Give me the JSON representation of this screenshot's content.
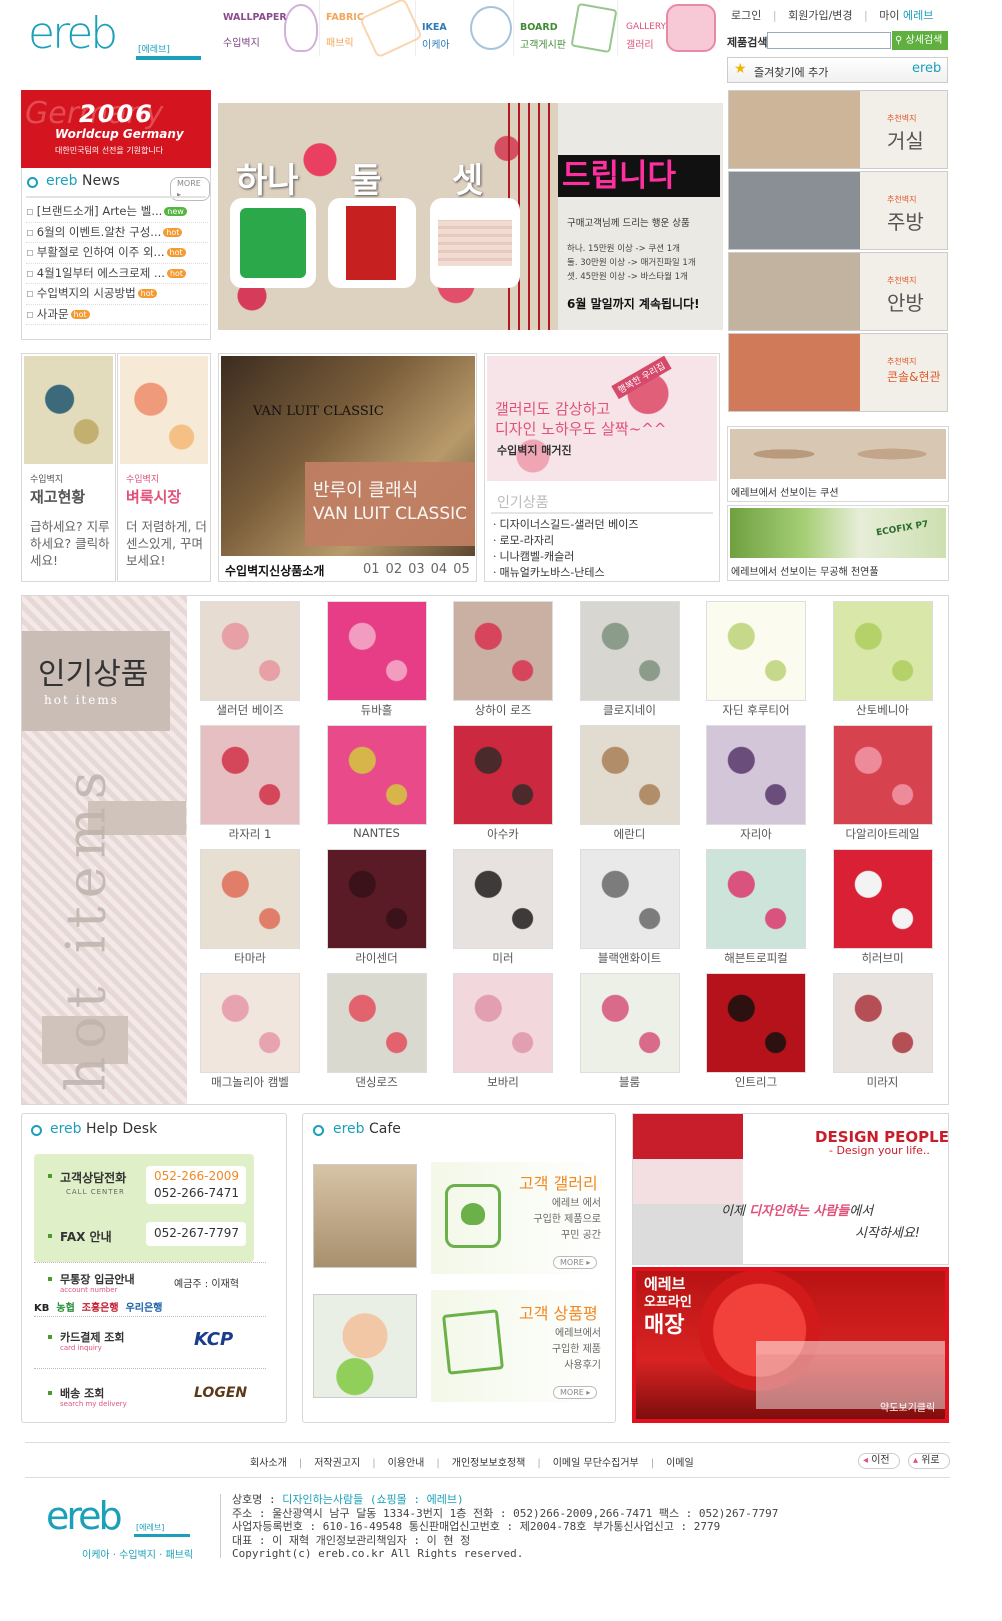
{
  "logo": {
    "text": "ereb",
    "sub": "[에레브]"
  },
  "topnav": [
    {
      "en": "WALLPAPER",
      "ko": "수입벽지"
    },
    {
      "en": "FABRIC",
      "ko": "패브릭"
    },
    {
      "en": "IKEA",
      "ko": "이케아"
    },
    {
      "en": "BOARD",
      "ko": "고객게시판"
    },
    {
      "en": "GALLERY",
      "ko": "갤러리"
    }
  ],
  "util": {
    "login": "로그인",
    "join": "회원가입/변경",
    "mypage": "마이",
    "mypage_brand": "에레브",
    "search_label": "제품검색",
    "search_placeholder": "",
    "search_btn": "상세검색",
    "favorite": "즐겨찾기에 추가",
    "fav_logo": "ereb"
  },
  "worldcup": {
    "year": "2006",
    "title": "Worldcup Germany",
    "bgtext": "Germany",
    "sub": "대한민국팀의 선전을 기원합니다"
  },
  "news": {
    "brand": "ereb",
    "title": "News",
    "more": "MORE ▸",
    "items": [
      {
        "text": "[브랜드소개] Arte는 벨...",
        "badge": "new"
      },
      {
        "text": "6월의 이벤트.알찬 구성...",
        "badge": "hot"
      },
      {
        "text": "부활절로 인하여 이주 외...",
        "badge": "hot"
      },
      {
        "text": "4월1일부터 에스크로제 ...",
        "badge": "hot"
      },
      {
        "text": "수입벽지의 시공방법",
        "badge": "hot"
      },
      {
        "text": "사과문",
        "badge": "hot"
      }
    ]
  },
  "banner": {
    "w1": "하나",
    "w2": "둘",
    "w3": "셋",
    "headline": "드립니다",
    "sub": "구매고객님께 드리는 행운 상품",
    "l1": "하나. 15만원 이상 -> 쿠션 1개",
    "l2": "둘. 30만원 이상 -> 매거진파일 1개",
    "l3": "셋. 45만원 이상 -> 바스타월 1개",
    "foot": "6월 말일까지 계속됩니다!"
  },
  "rooms": [
    {
      "tag": "추천벽지",
      "name": "거실"
    },
    {
      "tag": "추천벽지",
      "name": "주방"
    },
    {
      "tag": "추천벽지",
      "name": "안방"
    },
    {
      "tag": "추천벽지",
      "name": "콘솔&현관"
    }
  ],
  "stock": {
    "tag": "수입벽지",
    "title": "재고현황",
    "copy": "급하세요? 지루하세요? 클릭하세요!"
  },
  "flea": {
    "tag": "수입벽지",
    "title": "벼룩시장",
    "copy": "더 저렴하게, 더 센스있게, 꾸며보세요!"
  },
  "vanluit": {
    "overlay": "VAN LUIT CLASSIC",
    "title_ko": "반루이 클래식",
    "title_en": "VAN LUIT CLASSIC",
    "caption": "수입벽지신상품소개",
    "pages": [
      "01",
      "02",
      "03",
      "04",
      "05"
    ]
  },
  "gallery_banner": {
    "l1": "갤러리도 감상하고",
    "l2": "디자인 노하우도 살짝~^^",
    "l3": "수입벽지 매거진",
    "badge": "행복한 우리집"
  },
  "popular_small": {
    "title": "인기상품",
    "items": [
      "디자이너스길드-샐러던 베이즈",
      "로모-라자리",
      "니나캠벨-캐슬러",
      "매뉴얼카노바스-난테스"
    ]
  },
  "cushion": {
    "caption": "에레브에서 선보이는 쿠션"
  },
  "ecofix": {
    "caption": "에레브에서 선보이는 무공해 천연풀",
    "label": "ECOFIX P7"
  },
  "hot": {
    "title": "인기상품",
    "sub": "hot items",
    "side": "hot items",
    "products": [
      "샐러던 베이즈",
      "듀바홀",
      "상하이 로즈",
      "클로지네이",
      "자딘 후루티어",
      "산토베니아",
      "라자리 1",
      "NANTES",
      "아수카",
      "에란디",
      "자리아",
      "다알리아트레일",
      "타마라",
      "라이센더",
      "미러",
      "블랙앤화이트",
      "해븐트로피컬",
      "히러브미",
      "매그놀리아 캠벨",
      "댄싱로즈",
      "보바리",
      "블룸",
      "인트리그",
      "미라지"
    ]
  },
  "help": {
    "brand": "ereb",
    "title": "Help Desk",
    "tel_label": "고객상담전화",
    "tel_en": "CALL CENTER",
    "tel1": "052-266-2009",
    "tel2": "052-266-7471",
    "fax_label": "FAX 안내",
    "fax": "052-267-7797",
    "bank_label": "무통장 입금안내",
    "bank_en": "account number",
    "holder": "예금주 : 이재혁",
    "banks": [
      "KB",
      "농협",
      "조흥은행",
      "우리은행"
    ],
    "card_label": "카드결제 조회",
    "card_en": "card inquiry",
    "card_logo": "KCP",
    "ship_label": "배송 조회",
    "ship_en": "search my delivery",
    "ship_logo": "LOGEN"
  },
  "cafe": {
    "brand": "ereb",
    "title": "Cafe",
    "g_title": "고객 갤러리",
    "g_desc": [
      "에레브 에서",
      "구입한 제품으로",
      "꾸민 공간"
    ],
    "r_title": "고객 상품평",
    "r_desc": [
      "에레브에서",
      "구입한 제품",
      "사용후기"
    ],
    "more": "MORE ▸"
  },
  "design": {
    "title": "DESIGN PEOPLE",
    "sub": "- Design your life..",
    "copy1": "이제 ",
    "copy_hi": "디자인하는 사람들",
    "copy2": "에서",
    "copy3": "시작하세요!"
  },
  "offline": {
    "l1": "에레브",
    "l2": "오프라인",
    "l3": "매장",
    "btn": "약도보기클릭"
  },
  "footer_nav": [
    "회사소개",
    "저작권고지",
    "이용안내",
    "개인정보보호정책",
    "이메일 무단수집거부",
    "이메일"
  ],
  "footer_btns": {
    "prev": "이전",
    "top": "위로"
  },
  "footer": {
    "logo": "ereb",
    "logo_sub": "[에레브]",
    "tagline": "이케아 · 수입벽지 · 패브릭",
    "l1a": "상호명 : ",
    "l1b": "디자인하는사람들 (쇼핑몰 : 에레브)",
    "l2": "주소 : 울산광역시 남구 달동 1334-3번지 1층    전화 : 052)266-2009,266-7471    팩스 : 052)267-7797",
    "l3": "사업자등록번호 : 610-16-49548    통신판매업신고번호 : 제2004-78호    부가통신사업신고 : 2779",
    "l4": "대표 : 이 재혁      개인정보관리책임자 : 이 현 정",
    "l5": "Copyright(c) ereb.co.kr All Rights reserved."
  }
}
